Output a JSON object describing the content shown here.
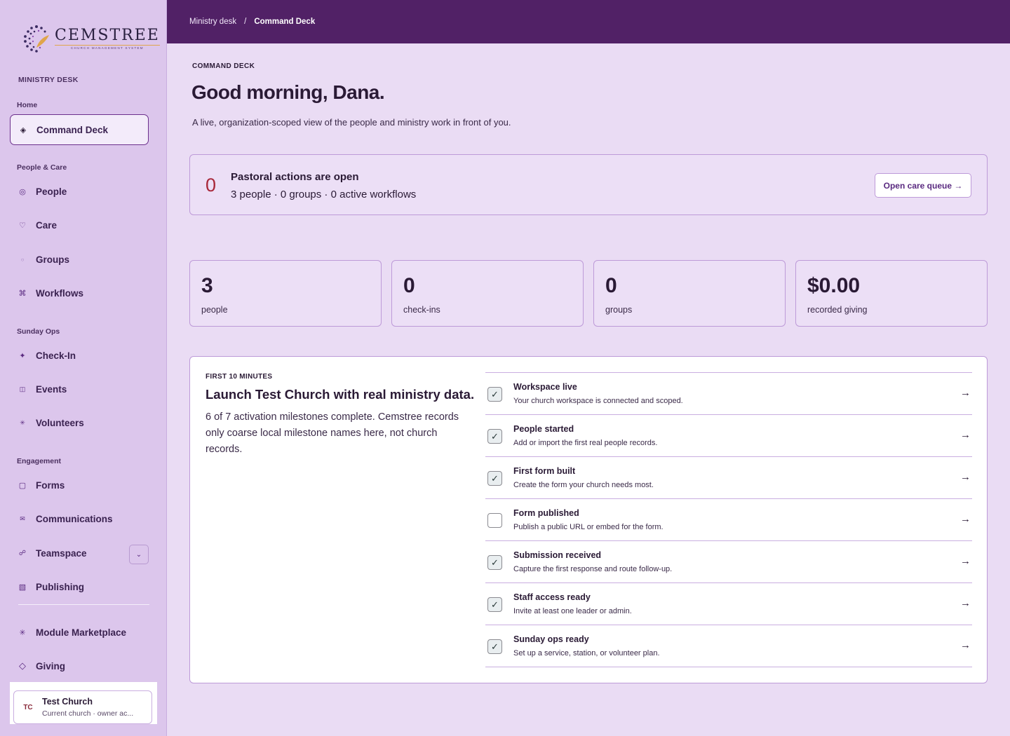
{
  "brand": {
    "name": "CEMSTREE",
    "tagline": "CHURCH MANAGEMENT SYSTEM"
  },
  "sidebar": {
    "section": "MINISTRY DESK",
    "home_label": "Home",
    "active": {
      "label": "Command Deck",
      "icon": "diamond-icon"
    },
    "groups": [
      {
        "label": "People & Care"
      },
      {
        "label": "Sunday Ops"
      },
      {
        "label": "Engagement"
      }
    ],
    "items": [
      {
        "label": "People",
        "icon": "circle-icon"
      },
      {
        "label": "Care",
        "icon": "heart-icon"
      },
      {
        "label": "Groups",
        "icon": "dot-icon"
      },
      {
        "label": "Workflows",
        "icon": "command-icon"
      },
      {
        "label": "Check-In",
        "icon": "sparkle-icon"
      },
      {
        "label": "Events",
        "icon": "calendar-icon"
      },
      {
        "label": "Volunteers",
        "icon": "asterisk-icon"
      },
      {
        "label": "Forms",
        "icon": "square-icon"
      },
      {
        "label": "Communications",
        "icon": "mail-icon"
      },
      {
        "label": "Teamspace",
        "icon": "link-icon"
      },
      {
        "label": "Publishing",
        "icon": "grid-icon"
      },
      {
        "label": "Module Marketplace",
        "icon": "star-icon"
      },
      {
        "label": "Giving",
        "icon": "diamond-outline-icon"
      }
    ],
    "org": {
      "initials": "TC",
      "name": "Test Church",
      "subtitle": "Current church · owner ac..."
    }
  },
  "breadcrumb": {
    "parent": "Ministry desk",
    "separator": "/",
    "current": "Command Deck"
  },
  "page": {
    "eyebrow": "COMMAND DECK",
    "title": "Good morning, Dana.",
    "subtitle": "A live, organization-scoped view of the people and ministry work in front of you."
  },
  "alert": {
    "count": "0",
    "title": "Pastoral actions are open",
    "summary": "3 people · 0 groups · 0 active workflows",
    "button": "Open care queue →"
  },
  "stats": [
    {
      "value": "3",
      "label": "people"
    },
    {
      "value": "0",
      "label": "check-ins"
    },
    {
      "value": "0",
      "label": "groups"
    },
    {
      "value": "$0.00",
      "label": "recorded giving"
    }
  ],
  "launch": {
    "eyebrow": "FIRST 10 MINUTES",
    "title": "Launch Test Church with real ministry data.",
    "description": "6 of 7 activation milestones complete. Cemstree records only coarse local milestone names here, not church records.",
    "milestones": [
      {
        "title": "Workspace live",
        "desc": "Your church workspace is connected and scoped.",
        "done": true
      },
      {
        "title": "People started",
        "desc": "Add or import the first real people records.",
        "done": true
      },
      {
        "title": "First form built",
        "desc": "Create the form your church needs most.",
        "done": true
      },
      {
        "title": "Form published",
        "desc": "Publish a public URL or embed for the form.",
        "done": false
      },
      {
        "title": "Submission received",
        "desc": "Capture the first response and route follow-up.",
        "done": true
      },
      {
        "title": "Staff access ready",
        "desc": "Invite at least one leader or admin.",
        "done": true
      },
      {
        "title": "Sunday ops ready",
        "desc": "Set up a service, station, or volunteer plan.",
        "done": true
      }
    ]
  },
  "colors": {
    "topbar": "#512166",
    "sidebar": "#dcc6ec",
    "page": "#eadcf4",
    "accent": "#6b2f8c",
    "alert_count": "#a8283a"
  }
}
